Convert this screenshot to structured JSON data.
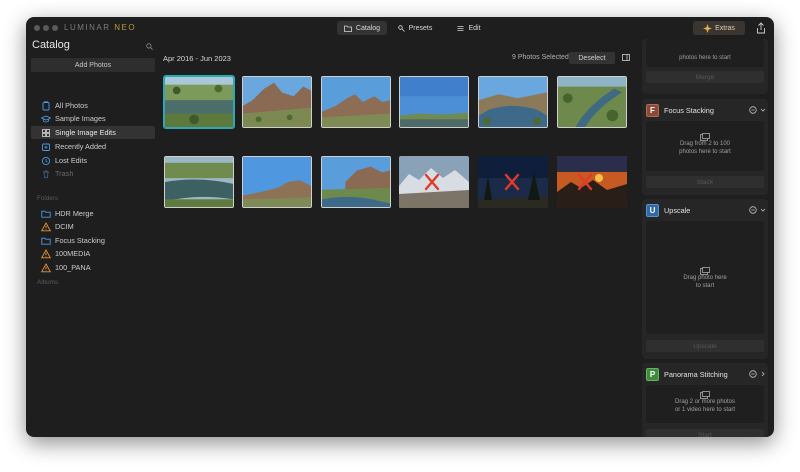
{
  "app": {
    "brand": "LUMINAR",
    "brand_suffix": "NEO",
    "tabs": [
      {
        "label": "Catalog"
      },
      {
        "label": "Presets"
      },
      {
        "label": "Edit"
      }
    ],
    "extras_label": "Extras"
  },
  "sidebar": {
    "title": "Catalog",
    "add_photos": "Add Photos",
    "items": [
      {
        "label": "All Photos"
      },
      {
        "label": "Sample Images"
      },
      {
        "label": "Single Image Edits"
      },
      {
        "label": "Recently Added"
      },
      {
        "label": "Lost Edits"
      },
      {
        "label": "Trash"
      }
    ],
    "folders_header": "Folders",
    "folders": [
      {
        "label": "HDR Merge"
      },
      {
        "label": "DCIM"
      },
      {
        "label": "Focus Stacking"
      },
      {
        "label": "100MEDIA"
      },
      {
        "label": "100_PANA"
      }
    ],
    "albums_header": "Albums"
  },
  "main": {
    "date_range": "Apr 2016 - Jun 2023",
    "selected_count": "9 Photos Selected",
    "deselect": "Deselect"
  },
  "right_panel": {
    "top_partial": {
      "text": "photos here to start",
      "button": "Merge"
    },
    "cards": [
      {
        "badge": "F",
        "title": "Focus Stacking",
        "line1": "Drag from 2 to 100",
        "line2": "photos here to start",
        "button": "Stack",
        "badge_color": "#8a4a3a"
      },
      {
        "badge": "U",
        "title": "Upscale",
        "line1": "Drag photo here",
        "line2": "to start",
        "button": "Upscale",
        "badge_color": "#2f6aa8"
      },
      {
        "badge": "P",
        "title": "Panorama Stitching",
        "line1": "Drag 2 or more photos",
        "line2": "or 1 video here to start",
        "button": "Start",
        "badge_color": "#3f8a3c"
      }
    ]
  },
  "colors": {
    "window_bg": "#1e1e1e",
    "selection_accent": "#2fa8b3",
    "missing_x": "#e03b2a"
  }
}
